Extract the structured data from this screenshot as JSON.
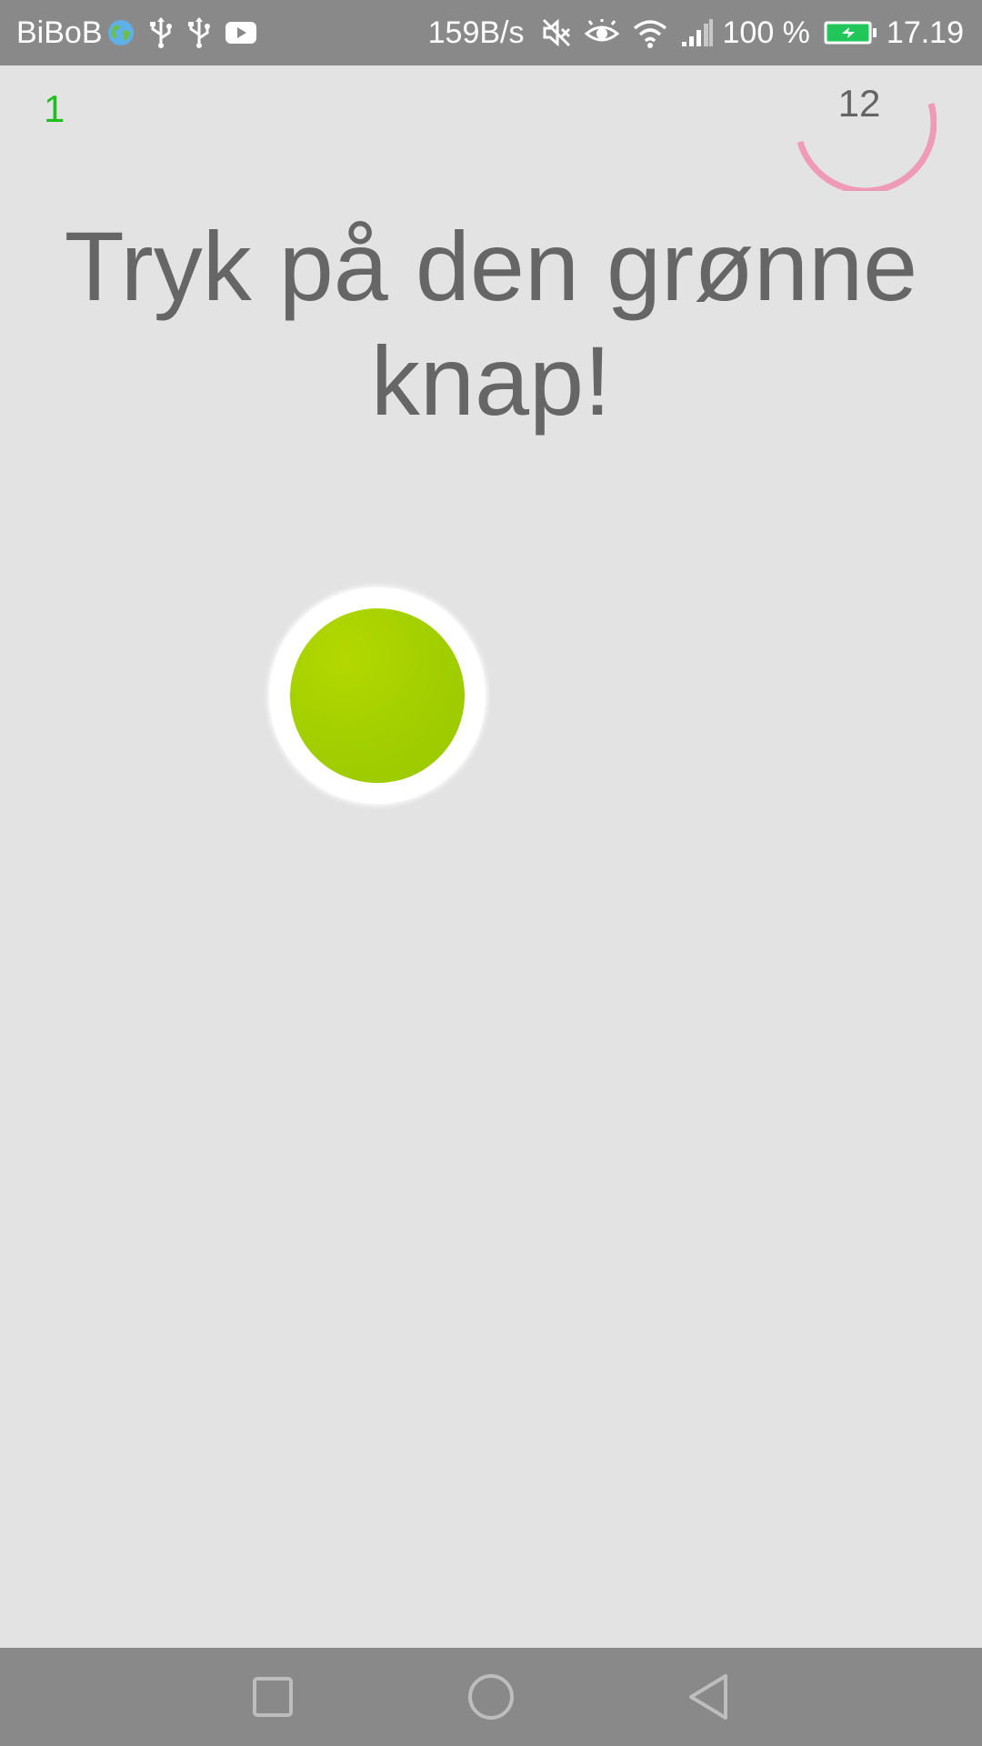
{
  "status_bar": {
    "carrier": "BiBoB",
    "icons_left": [
      "globe-icon",
      "usb-icon",
      "usb-icon",
      "youtube-icon"
    ],
    "net_speed": "159B/s",
    "icons_right": [
      "mute-icon",
      "eye-comfort-icon",
      "wifi-icon",
      "signal-icon"
    ],
    "battery": "100 %",
    "battery_state": "charging",
    "time": "17.19"
  },
  "game": {
    "score": "1",
    "score_color": "#1fbf1f",
    "timer_value": "12",
    "timer_ring_color": "#ef9ab7",
    "instruction_line1": "Tryk på den grønne",
    "instruction_line2": "knap!",
    "target_color": "#a4d000"
  },
  "nav_bar": {
    "buttons": [
      "recents-icon",
      "home-icon",
      "back-icon"
    ]
  }
}
